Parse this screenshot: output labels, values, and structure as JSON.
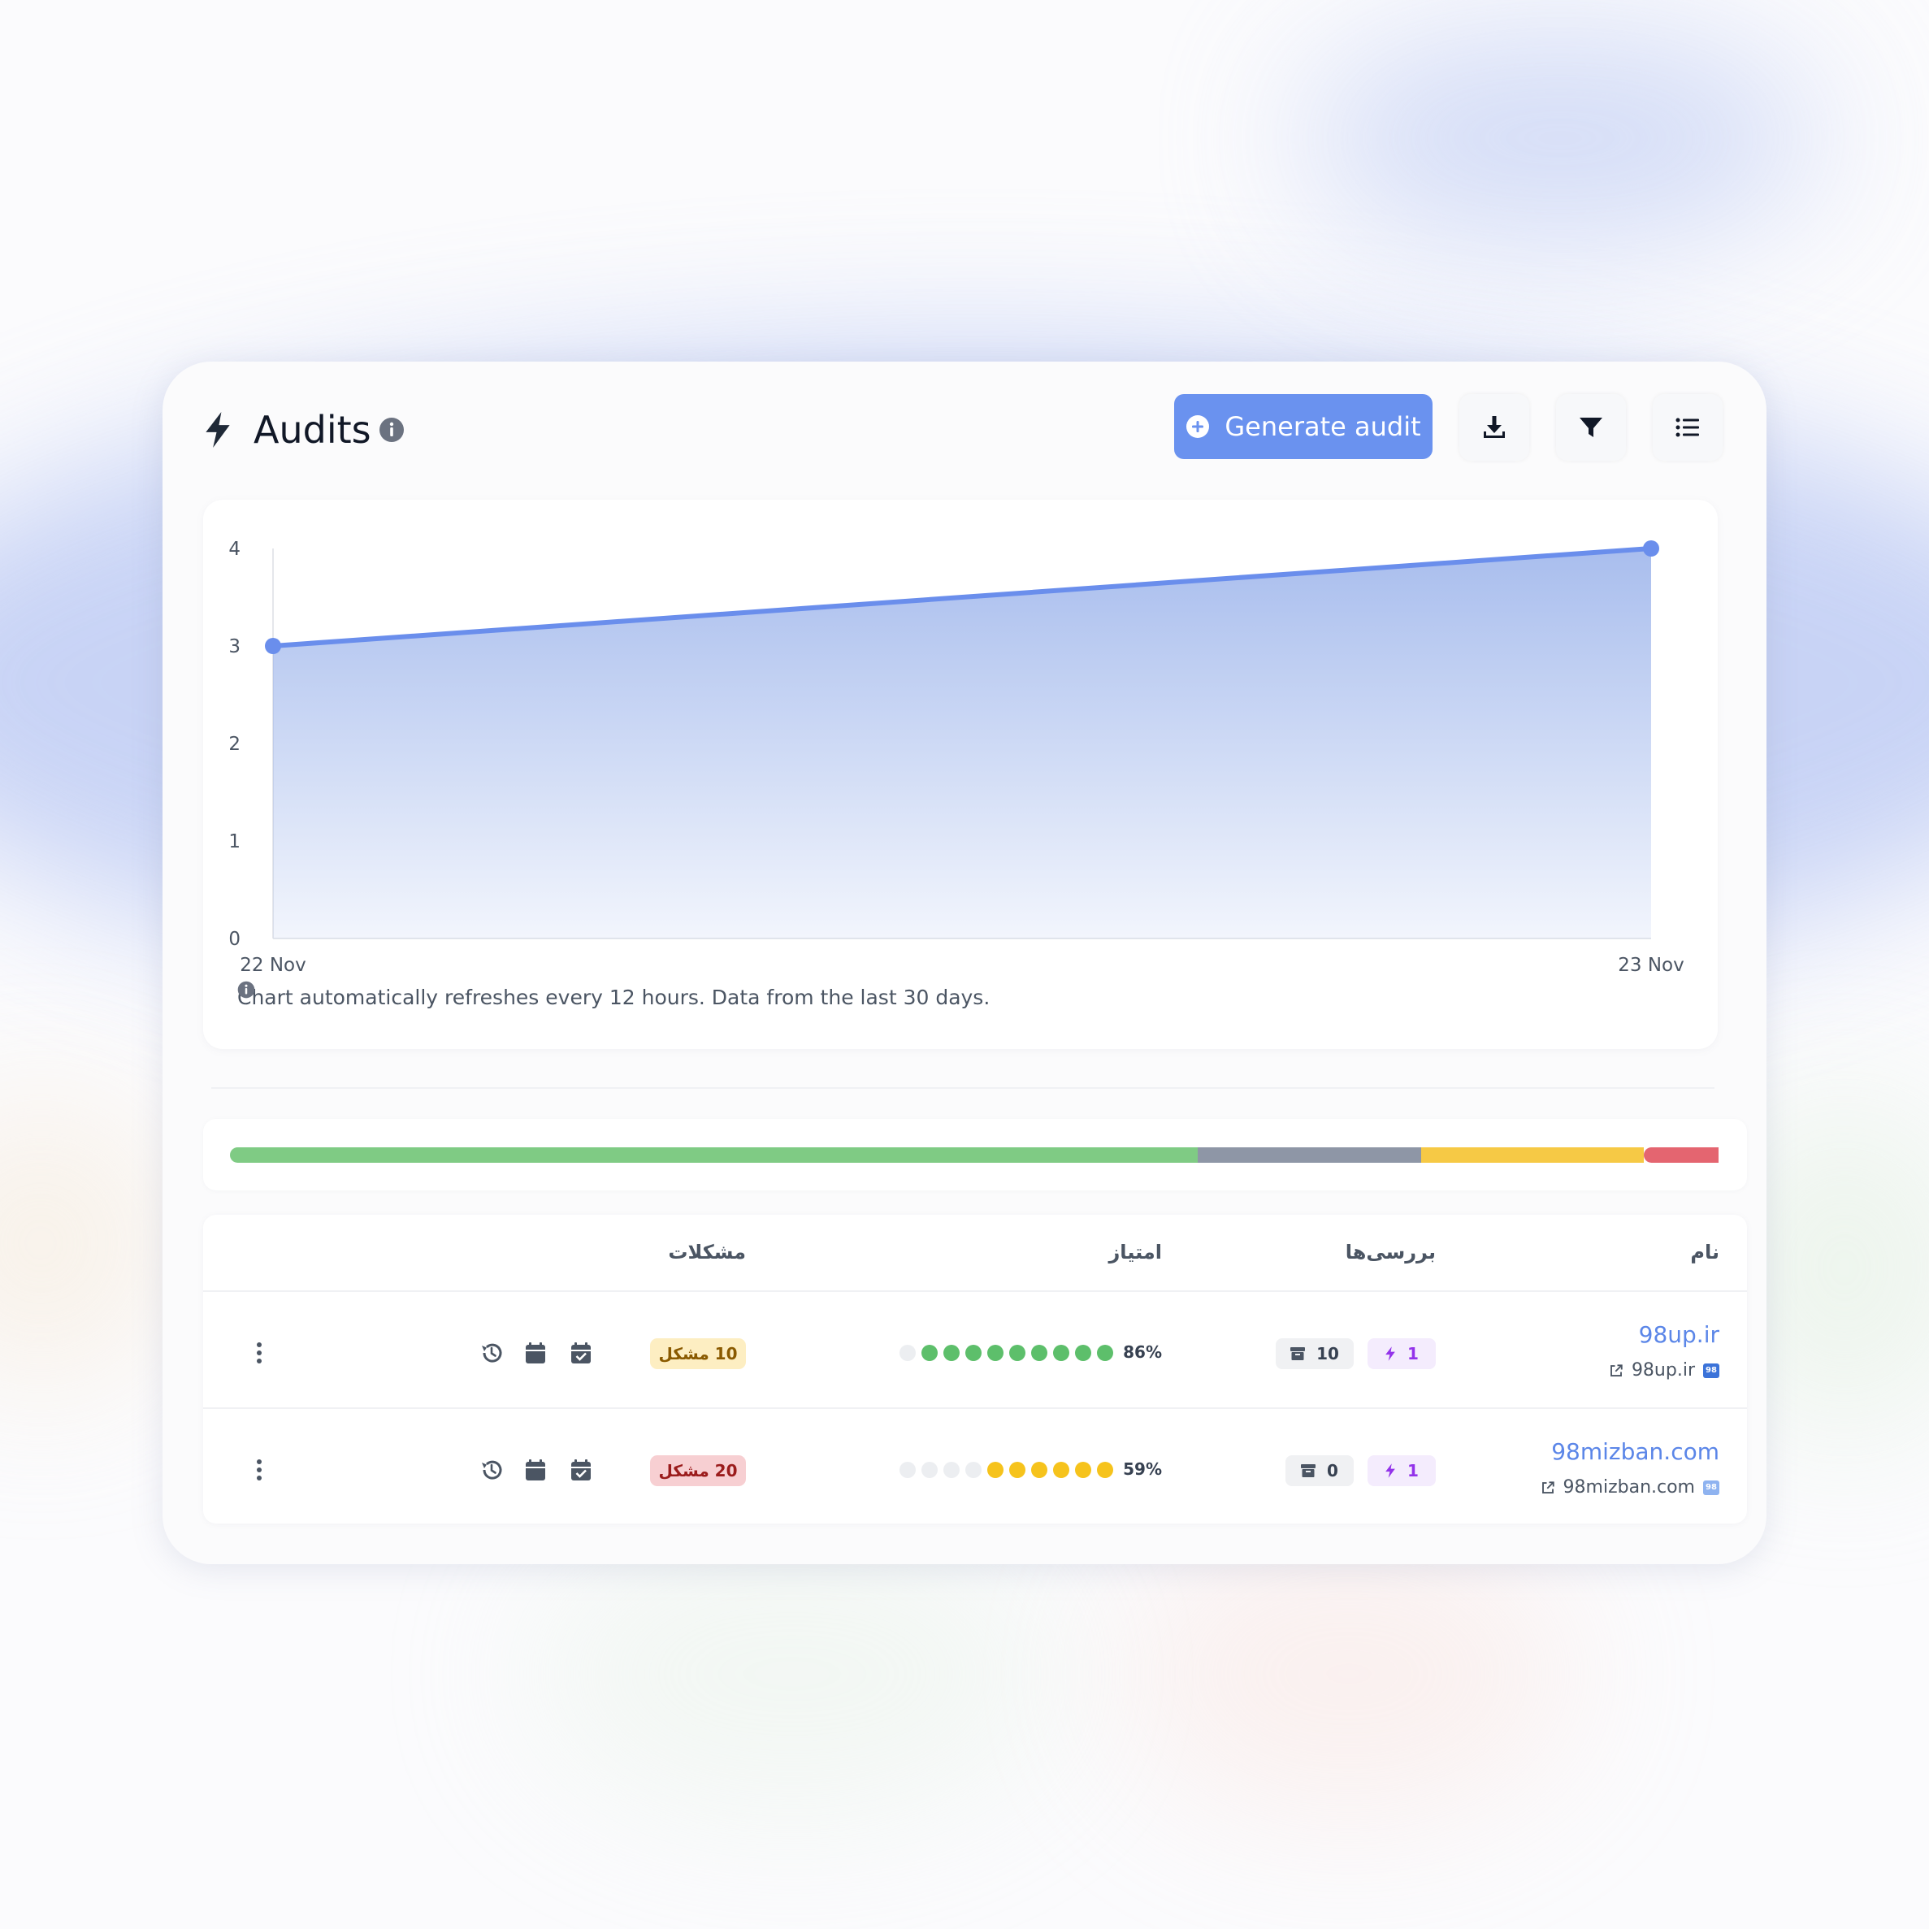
{
  "header": {
    "title": "Audits",
    "generate_label": "Generate audit"
  },
  "icons": {
    "title": "bolt-icon",
    "title_info": "info-icon",
    "generate": "plus-circle-icon",
    "toolbar": [
      "download-icon",
      "filter-icon",
      "list-icon"
    ],
    "row_actions": [
      "history-icon",
      "calendar-icon",
      "calendar-check-icon",
      "more-vertical-icon"
    ]
  },
  "colors": {
    "accent": "#6a92ef",
    "line": "#6a8eec",
    "good": "#5dbf6b",
    "warning": "#f6c31c",
    "bad": "#e46570",
    "neutral": "#8e96a6"
  },
  "chart_data": {
    "type": "area",
    "x": [
      "22 Nov",
      "23 Nov"
    ],
    "series": [
      {
        "values": [
          3,
          4
        ]
      }
    ],
    "y_ticks": [
      "0",
      "1",
      "2",
      "3",
      "4"
    ],
    "ylim": [
      0,
      4
    ],
    "grid": false,
    "legend": "none"
  },
  "chart_note": "Chart automatically refreshes every 12 hours. Data from the last 30 days.",
  "distribution": [
    {
      "status": "good",
      "color": "#7fcb84",
      "share": 0.65
    },
    {
      "status": "neutral",
      "color": "#8e96a6",
      "share": 0.15
    },
    {
      "status": "warning",
      "color": "#f6c945",
      "share": 0.15
    },
    {
      "status": "bad",
      "color": "#e46570",
      "share": 0.05
    }
  ],
  "table": {
    "columns": {
      "name": "نام",
      "audits": "بررسی‌ها",
      "score": "امتیاز",
      "issues": "مشکلات"
    },
    "rows": [
      {
        "name": "98up.ir",
        "domain": "98up.ir",
        "favicon": "98",
        "audits_count": "1",
        "archive_count": "10",
        "score": "86%",
        "score_level": 9,
        "score_color": "#5dbf6b",
        "issues": "10 مشکل",
        "issues_level": "warning"
      },
      {
        "name": "98mizban.com",
        "domain": "98mizban.com",
        "favicon": "98",
        "audits_count": "1",
        "archive_count": "0",
        "score": "59%",
        "score_level": 6,
        "score_color": "#f6c31c",
        "issues": "20 مشکل",
        "issues_level": "bad"
      }
    ]
  }
}
